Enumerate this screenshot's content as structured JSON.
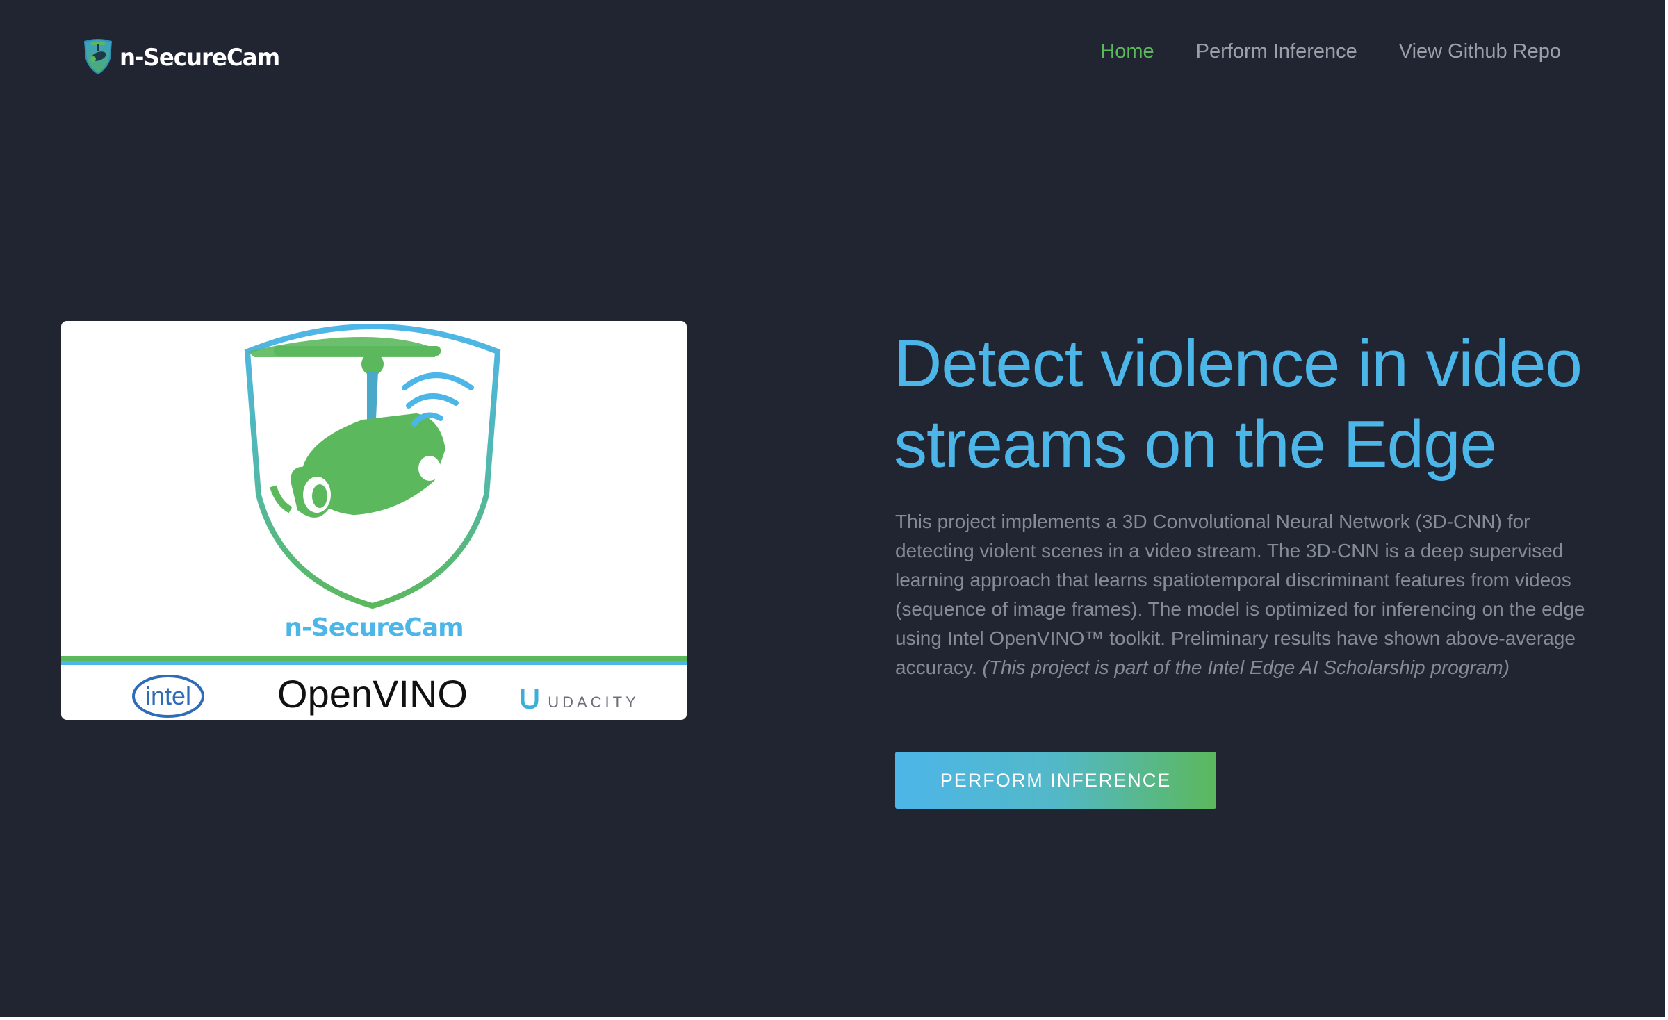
{
  "header": {
    "logo_text": "n-SecureCam",
    "nav": [
      {
        "label": "Home",
        "active": true
      },
      {
        "label": "Perform Inference",
        "active": false
      },
      {
        "label": "View Github Repo",
        "active": false
      }
    ]
  },
  "hero": {
    "title": "Detect violence in video streams on the Edge",
    "description": "This project implements a 3D Convolutional Neural Network (3D-CNN) for detecting violent scenes in a video stream. The 3D-CNN is a deep supervised learning approach that learns spatiotemporal discriminant features from videos (sequence of image frames). The model is optimized for inferencing on the edge using Intel OpenVINO™ toolkit. Preliminary results have shown above-average accuracy.",
    "description_note": "(This project is part of the Intel Edge AI Scholarship program)",
    "cta_label": "PERFORM INFERENCE",
    "image": {
      "brand_text": "n-SecureCam",
      "partner_logos": [
        "intel",
        "OpenVINO",
        "UDACITY"
      ]
    }
  },
  "colors": {
    "background": "#212532",
    "accent_blue": "#4db6e8",
    "accent_green": "#5cb85c",
    "nav_text": "#9aa0a8",
    "body_text": "#868c96"
  },
  "icons": {
    "logo": "shield-camera-icon"
  }
}
